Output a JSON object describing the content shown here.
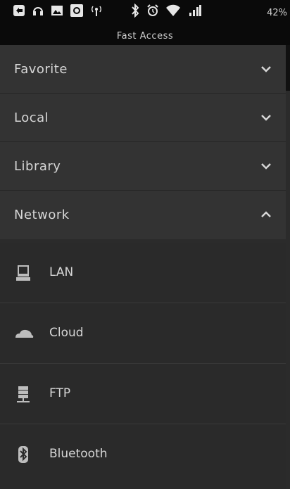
{
  "status_bar": {
    "icons": [
      "notification-icon",
      "headset-icon",
      "image-icon",
      "app-icon",
      "signal-tower-icon",
      "bluetooth-icon",
      "alarm-icon",
      "wifi-icon",
      "cell-signal-icon"
    ],
    "battery": "42%"
  },
  "header": {
    "title": "Fast Access"
  },
  "sections": [
    {
      "label": "Favorite",
      "expanded": false
    },
    {
      "label": "Local",
      "expanded": false
    },
    {
      "label": "Library",
      "expanded": false
    },
    {
      "label": "Network",
      "expanded": true
    }
  ],
  "network_items": [
    {
      "label": "LAN",
      "icon": "computer-icon"
    },
    {
      "label": "Cloud",
      "icon": "cloud-icon"
    },
    {
      "label": "FTP",
      "icon": "ftp-server-icon"
    },
    {
      "label": "Bluetooth",
      "icon": "bluetooth-icon"
    }
  ],
  "colors": {
    "background": "#2b2b2b",
    "section_bg": "#333333",
    "status_bar": "#0a0a0a",
    "text": "#d6d6d6"
  }
}
